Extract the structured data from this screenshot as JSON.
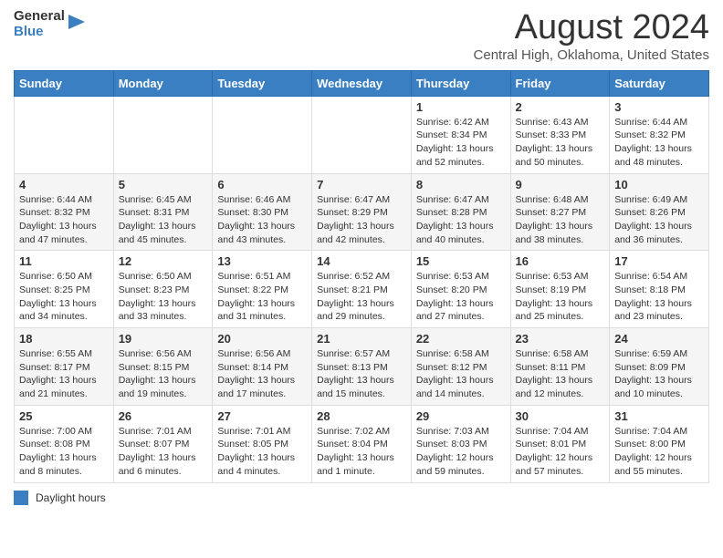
{
  "logo": {
    "general": "General",
    "blue": "Blue"
  },
  "title": "August 2024",
  "subtitle": "Central High, Oklahoma, United States",
  "days_header": [
    "Sunday",
    "Monday",
    "Tuesday",
    "Wednesday",
    "Thursday",
    "Friday",
    "Saturday"
  ],
  "weeks": [
    [
      {
        "day": "",
        "info": ""
      },
      {
        "day": "",
        "info": ""
      },
      {
        "day": "",
        "info": ""
      },
      {
        "day": "",
        "info": ""
      },
      {
        "day": "1",
        "info": "Sunrise: 6:42 AM\nSunset: 8:34 PM\nDaylight: 13 hours and 52 minutes."
      },
      {
        "day": "2",
        "info": "Sunrise: 6:43 AM\nSunset: 8:33 PM\nDaylight: 13 hours and 50 minutes."
      },
      {
        "day": "3",
        "info": "Sunrise: 6:44 AM\nSunset: 8:32 PM\nDaylight: 13 hours and 48 minutes."
      }
    ],
    [
      {
        "day": "4",
        "info": "Sunrise: 6:44 AM\nSunset: 8:32 PM\nDaylight: 13 hours and 47 minutes."
      },
      {
        "day": "5",
        "info": "Sunrise: 6:45 AM\nSunset: 8:31 PM\nDaylight: 13 hours and 45 minutes."
      },
      {
        "day": "6",
        "info": "Sunrise: 6:46 AM\nSunset: 8:30 PM\nDaylight: 13 hours and 43 minutes."
      },
      {
        "day": "7",
        "info": "Sunrise: 6:47 AM\nSunset: 8:29 PM\nDaylight: 13 hours and 42 minutes."
      },
      {
        "day": "8",
        "info": "Sunrise: 6:47 AM\nSunset: 8:28 PM\nDaylight: 13 hours and 40 minutes."
      },
      {
        "day": "9",
        "info": "Sunrise: 6:48 AM\nSunset: 8:27 PM\nDaylight: 13 hours and 38 minutes."
      },
      {
        "day": "10",
        "info": "Sunrise: 6:49 AM\nSunset: 8:26 PM\nDaylight: 13 hours and 36 minutes."
      }
    ],
    [
      {
        "day": "11",
        "info": "Sunrise: 6:50 AM\nSunset: 8:25 PM\nDaylight: 13 hours and 34 minutes."
      },
      {
        "day": "12",
        "info": "Sunrise: 6:50 AM\nSunset: 8:23 PM\nDaylight: 13 hours and 33 minutes."
      },
      {
        "day": "13",
        "info": "Sunrise: 6:51 AM\nSunset: 8:22 PM\nDaylight: 13 hours and 31 minutes."
      },
      {
        "day": "14",
        "info": "Sunrise: 6:52 AM\nSunset: 8:21 PM\nDaylight: 13 hours and 29 minutes."
      },
      {
        "day": "15",
        "info": "Sunrise: 6:53 AM\nSunset: 8:20 PM\nDaylight: 13 hours and 27 minutes."
      },
      {
        "day": "16",
        "info": "Sunrise: 6:53 AM\nSunset: 8:19 PM\nDaylight: 13 hours and 25 minutes."
      },
      {
        "day": "17",
        "info": "Sunrise: 6:54 AM\nSunset: 8:18 PM\nDaylight: 13 hours and 23 minutes."
      }
    ],
    [
      {
        "day": "18",
        "info": "Sunrise: 6:55 AM\nSunset: 8:17 PM\nDaylight: 13 hours and 21 minutes."
      },
      {
        "day": "19",
        "info": "Sunrise: 6:56 AM\nSunset: 8:15 PM\nDaylight: 13 hours and 19 minutes."
      },
      {
        "day": "20",
        "info": "Sunrise: 6:56 AM\nSunset: 8:14 PM\nDaylight: 13 hours and 17 minutes."
      },
      {
        "day": "21",
        "info": "Sunrise: 6:57 AM\nSunset: 8:13 PM\nDaylight: 13 hours and 15 minutes."
      },
      {
        "day": "22",
        "info": "Sunrise: 6:58 AM\nSunset: 8:12 PM\nDaylight: 13 hours and 14 minutes."
      },
      {
        "day": "23",
        "info": "Sunrise: 6:58 AM\nSunset: 8:11 PM\nDaylight: 13 hours and 12 minutes."
      },
      {
        "day": "24",
        "info": "Sunrise: 6:59 AM\nSunset: 8:09 PM\nDaylight: 13 hours and 10 minutes."
      }
    ],
    [
      {
        "day": "25",
        "info": "Sunrise: 7:00 AM\nSunset: 8:08 PM\nDaylight: 13 hours and 8 minutes."
      },
      {
        "day": "26",
        "info": "Sunrise: 7:01 AM\nSunset: 8:07 PM\nDaylight: 13 hours and 6 minutes."
      },
      {
        "day": "27",
        "info": "Sunrise: 7:01 AM\nSunset: 8:05 PM\nDaylight: 13 hours and 4 minutes."
      },
      {
        "day": "28",
        "info": "Sunrise: 7:02 AM\nSunset: 8:04 PM\nDaylight: 13 hours and 1 minute."
      },
      {
        "day": "29",
        "info": "Sunrise: 7:03 AM\nSunset: 8:03 PM\nDaylight: 12 hours and 59 minutes."
      },
      {
        "day": "30",
        "info": "Sunrise: 7:04 AM\nSunset: 8:01 PM\nDaylight: 12 hours and 57 minutes."
      },
      {
        "day": "31",
        "info": "Sunrise: 7:04 AM\nSunset: 8:00 PM\nDaylight: 12 hours and 55 minutes."
      }
    ]
  ],
  "legend": {
    "label": "Daylight hours"
  }
}
